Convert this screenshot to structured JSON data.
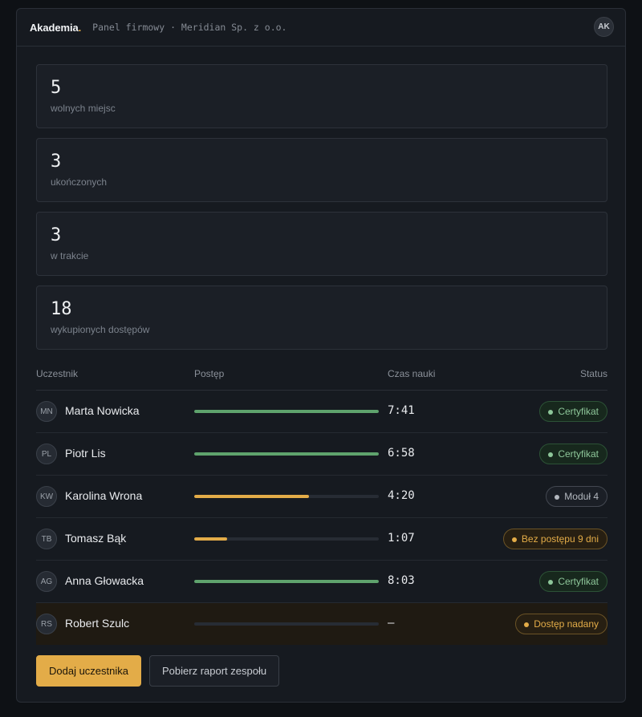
{
  "header": {
    "brand": "Akademia",
    "brand_dot": ".",
    "subtitle": "Panel firmowy · Meridian Sp. z o.o.",
    "user_initials": "AK"
  },
  "stats": [
    {
      "value": "5",
      "label": "wolnych miejsc"
    },
    {
      "value": "3",
      "label": "ukończonych"
    },
    {
      "value": "3",
      "label": "w trakcie"
    },
    {
      "value": "18",
      "label": "wykupionych dostępów"
    }
  ],
  "table": {
    "columns": [
      "Uczestnik",
      "Postęp",
      "Czas nauki",
      "Status"
    ],
    "rows": [
      {
        "initials": "MN",
        "name": "Marta Nowicka",
        "progress": 100,
        "time": "7:41",
        "status": "Certyfikat",
        "status_kind": "green",
        "bar_color": "#5fa36d"
      },
      {
        "initials": "PL",
        "name": "Piotr Lis",
        "progress": 100,
        "time": "6:58",
        "status": "Certyfikat",
        "status_kind": "green",
        "bar_color": "#5fa36d"
      },
      {
        "initials": "KW",
        "name": "Karolina Wrona",
        "progress": 62,
        "time": "4:20",
        "status": "Moduł 4",
        "status_kind": "gray",
        "bar_color": "#e3ac48"
      },
      {
        "initials": "TB",
        "name": "Tomasz Bąk",
        "progress": 18,
        "time": "1:07",
        "status": "Bez postępu 9 dni",
        "status_kind": "amber",
        "bar_color": "#e3ac48"
      },
      {
        "initials": "AG",
        "name": "Anna Głowacka",
        "progress": 100,
        "time": "8:03",
        "status": "Certyfikat",
        "status_kind": "green",
        "bar_color": "#5fa36d"
      },
      {
        "initials": "RS",
        "name": "Robert Szulc",
        "progress": 0,
        "time": "—",
        "status": "Dostęp nadany",
        "status_kind": "amber",
        "bar_color": "#e3ac48",
        "highlight": true
      }
    ]
  },
  "actions": {
    "add_label": "Dodaj uczestnika",
    "report_label": "Pobierz raport zespołu"
  },
  "colors": {
    "accent": "#e3ac48",
    "success": "#5fa36d",
    "background": "#161a20"
  }
}
